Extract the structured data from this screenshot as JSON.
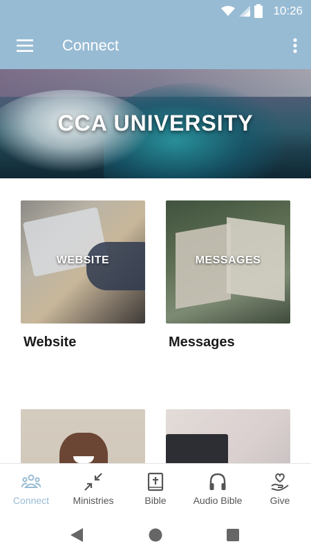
{
  "status_bar": {
    "time": "10:26"
  },
  "app_bar": {
    "title": "Connect"
  },
  "hero": {
    "title": "CCA UNIVERSITY"
  },
  "cards": [
    {
      "overlay": "WEBSITE",
      "title": "Website"
    },
    {
      "overlay": "MESSAGES",
      "title": "Messages"
    },
    {
      "overlay": "",
      "title": ""
    },
    {
      "overlay": "",
      "title": ""
    }
  ],
  "bottom_nav": {
    "items": [
      {
        "label": "Connect",
        "icon": "people-icon",
        "active": true
      },
      {
        "label": "Ministries",
        "icon": "collapse-arrows-icon",
        "active": false
      },
      {
        "label": "Bible",
        "icon": "bible-icon",
        "active": false
      },
      {
        "label": "Audio Bible",
        "icon": "headphones-icon",
        "active": false
      },
      {
        "label": "Give",
        "icon": "heart-hand-icon",
        "active": false
      }
    ]
  },
  "colors": {
    "primary": "#98bbd4",
    "text_dark": "#1a1a1a",
    "nav_inactive": "#555555"
  }
}
